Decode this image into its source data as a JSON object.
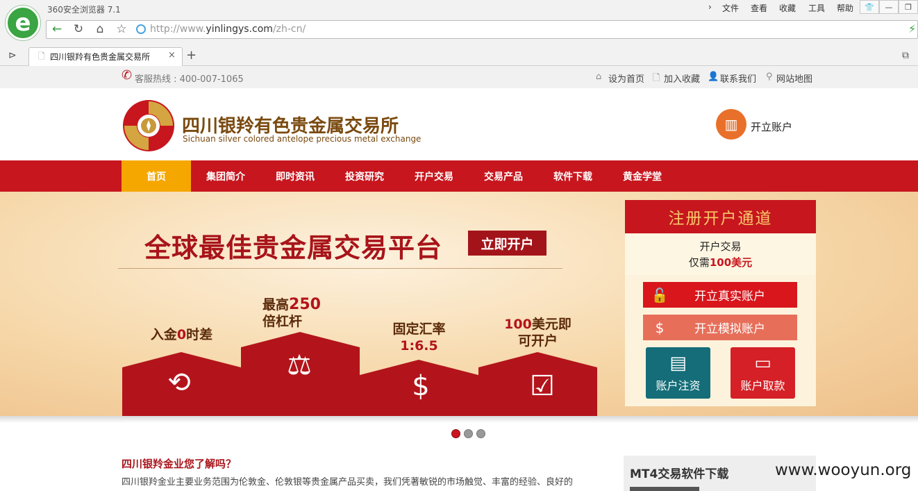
{
  "browser": {
    "app_name": "360安全浏览器 7.1",
    "menu": [
      "文件",
      "查看",
      "收藏",
      "工具",
      "帮助"
    ],
    "url_prefix": "http://www.",
    "url_domain": "yinlingys.com",
    "url_suffix": "/zh-cn/",
    "tab_title": "四川银羚有色贵金属交易所",
    "new_tab": "+"
  },
  "topbar": {
    "hotline": "客服热线 : 400-007-1065",
    "links": [
      "设为首页",
      "加入收藏",
      "联系我们",
      "网站地图"
    ]
  },
  "header": {
    "logo_cn": "四川银羚有色贵金属交易所",
    "logo_en": "Sichuan silver colored antelope precious metal exchange",
    "open_account": "开立账户"
  },
  "nav": [
    "首页",
    "集团简介",
    "即时资讯",
    "投资研究",
    "开户交易",
    "交易产品",
    "软件下载",
    "黄金学堂"
  ],
  "banner": {
    "slogan": "全球最佳贵金属交易平台",
    "cta": "立即开户",
    "features": [
      {
        "pre": "入金",
        "em": "0",
        "post": "时差",
        "line2": ""
      },
      {
        "pre": "最高",
        "em": "250",
        "post": "",
        "line2": "倍杠杆"
      },
      {
        "pre": "固定汇率",
        "em": "",
        "post": "",
        "line2": "1:6.5"
      },
      {
        "pre": "",
        "em": "100",
        "post": "美元即",
        "line2": "可开户"
      }
    ]
  },
  "register": {
    "title": "注册开户通道",
    "sub1": "开户交易",
    "sub2_pre": "仅需",
    "sub2_em": "100美元",
    "real": "开立真实账户",
    "demo": "开立模拟账户",
    "deposit": "账户注资",
    "withdraw": "账户取款"
  },
  "about": {
    "title": "四川银羚金业您了解吗？",
    "text": "四川银羚金业主要业务范围为伦敦金、伦敦银等贵金属产品买卖，我们凭著敏锐的市场触觉、丰富的经验、良好的"
  },
  "sidebar": {
    "mt4_title": "MT4交易软件下载"
  },
  "watermark": "www.wooyun.org",
  "colors": {
    "brand_red": "#c7161e",
    "nav_active": "#f5a700",
    "banner_red": "#b3141b"
  }
}
